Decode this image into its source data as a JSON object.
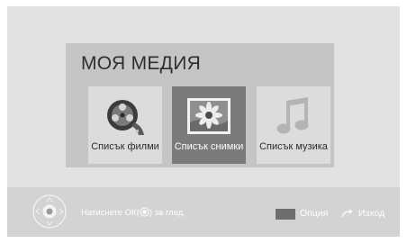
{
  "panel": {
    "title": "МОЯ МЕДИЯ"
  },
  "items": [
    {
      "label": "Списък филми",
      "icon": "film-reel-icon",
      "selected": false
    },
    {
      "label": "Списък снимки",
      "icon": "photo-flower-icon",
      "selected": true
    },
    {
      "label": "Списък музика",
      "icon": "music-note-icon",
      "selected": false
    }
  ],
  "footer": {
    "hint_prefix": "Натиснете ОК(",
    "hint_suffix": ") за глед.",
    "option_label": "Опция",
    "exit_label": "Изход"
  },
  "colors": {
    "selected_tile": "#7b7b7b",
    "panel": "#c5c5c5",
    "background": "#e2e2e2"
  }
}
